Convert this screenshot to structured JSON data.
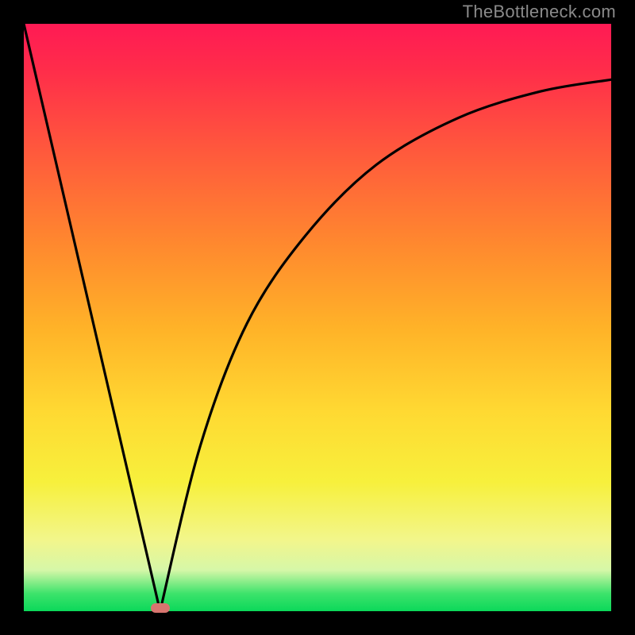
{
  "watermark": {
    "text": "TheBottleneck.com"
  },
  "chart_data": {
    "type": "line",
    "title": "",
    "xlabel": "",
    "ylabel": "",
    "xlim": [
      0,
      1
    ],
    "ylim": [
      0,
      1
    ],
    "series": [
      {
        "name": "left-branch",
        "x": [
          0.0,
          0.232
        ],
        "values": [
          1.0,
          0.0
        ]
      },
      {
        "name": "right-branch",
        "x": [
          0.232,
          0.3,
          0.38,
          0.48,
          0.6,
          0.74,
          0.88,
          1.0
        ],
        "values": [
          0.0,
          0.28,
          0.49,
          0.64,
          0.76,
          0.84,
          0.885,
          0.905
        ]
      }
    ],
    "marker": {
      "x": 0.232,
      "y": 0.0
    },
    "background": "thermal-gradient"
  }
}
